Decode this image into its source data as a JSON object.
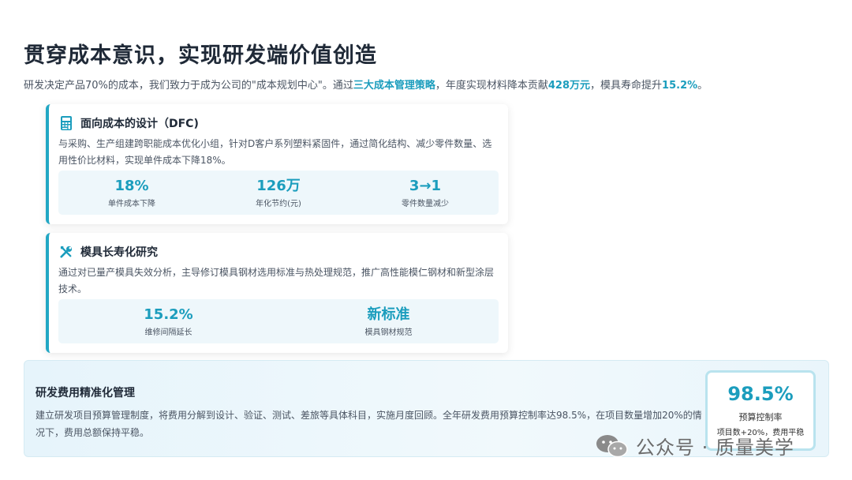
{
  "title": "贯穿成本意识，实现研发端价值创造",
  "subtitle": {
    "part1": "研发决定产品70%的成本，我们致力于成为公司的\"成本规划中心\"。通过",
    "hl1": "三大成本管理策略",
    "part2": "，年度实现材料降本贡献",
    "hl2": "428万元",
    "part3": "，模具寿命提升",
    "hl3": "15.2%",
    "part4": "。"
  },
  "cards": [
    {
      "icon": "calculator-icon",
      "title": "面向成本的设计（DFC)",
      "text": "与采购、生产组建跨职能成本优化小组，针对D客户系列塑料紧固件，通过简化结构、减少零件数量、选用性价比材料，实现单件成本下降18%。",
      "stats": [
        {
          "value": "18%",
          "label": "单件成本下降"
        },
        {
          "value": "126万",
          "label": "年化节约(元)"
        },
        {
          "value": "3→1",
          "label": "零件数量减少"
        }
      ]
    },
    {
      "icon": "tools-icon",
      "title": "模具长寿化研究",
      "text": "通过对已量产模具失效分析，主导修订模具钢材选用标准与热处理规范，推广高性能模仁钢材和新型涂层技术。",
      "stats": [
        {
          "value": "15.2%",
          "label": "维修间隔延长"
        },
        {
          "value": "新标准",
          "label": "模具钢材规范"
        }
      ]
    }
  ],
  "panel": {
    "title": "研发费用精准化管理",
    "text": "建立研发项目预算管理制度，将费用分解到设计、验证、测试、差旅等具体科目，实施月度回顾。全年研发费用预算控制率达98.5%，在项目数量增加20%的情况下，费用总额保持平稳。",
    "kpi": {
      "value": "98.5%",
      "label": "预算控制率",
      "sub": "项目数+20%，费用平稳"
    }
  },
  "watermark": {
    "icon": "wechat-icon",
    "text": "公众号 · 质量美学"
  }
}
